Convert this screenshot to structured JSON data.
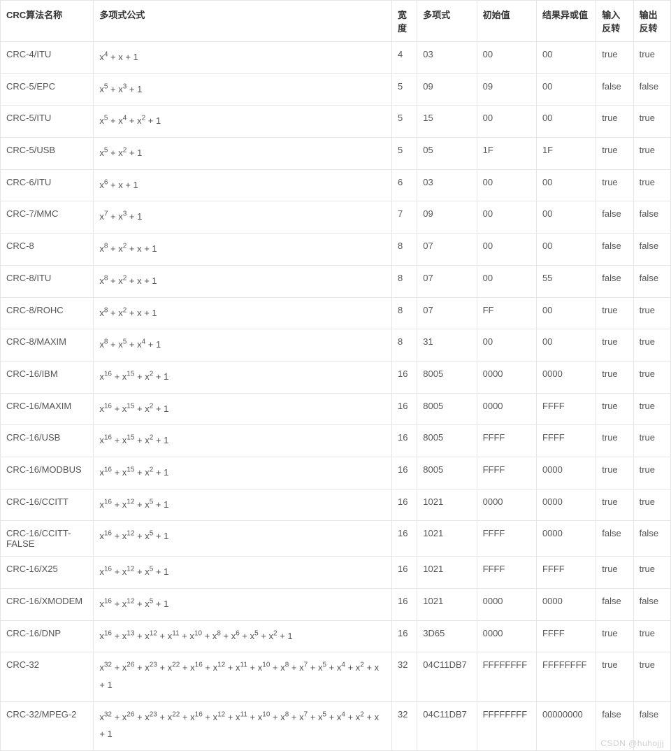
{
  "headers": {
    "name": "CRC算法名称",
    "poly_formula": "多项式公式",
    "width": "宽度",
    "poly": "多项式",
    "init": "初始值",
    "xorout": "结果异或值",
    "refin": "输入反转",
    "refout": "输出反转"
  },
  "watermark": "CSDN @huhojjj",
  "rows": [
    {
      "name": "CRC-4/ITU",
      "exps": [
        4,
        1,
        0
      ],
      "width": "4",
      "poly": "03",
      "init": "00",
      "xorout": "00",
      "refin": "true",
      "refout": "true"
    },
    {
      "name": "CRC-5/EPC",
      "exps": [
        5,
        3,
        0
      ],
      "width": "5",
      "poly": "09",
      "init": "09",
      "xorout": "00",
      "refin": "false",
      "refout": "false"
    },
    {
      "name": "CRC-5/ITU",
      "exps": [
        5,
        4,
        2,
        0
      ],
      "width": "5",
      "poly": "15",
      "init": "00",
      "xorout": "00",
      "refin": "true",
      "refout": "true"
    },
    {
      "name": "CRC-5/USB",
      "exps": [
        5,
        2,
        0
      ],
      "width": "5",
      "poly": "05",
      "init": "1F",
      "xorout": "1F",
      "refin": "true",
      "refout": "true"
    },
    {
      "name": "CRC-6/ITU",
      "exps": [
        6,
        1,
        0
      ],
      "width": "6",
      "poly": "03",
      "init": "00",
      "xorout": "00",
      "refin": "true",
      "refout": "true"
    },
    {
      "name": "CRC-7/MMC",
      "exps": [
        7,
        3,
        0
      ],
      "width": "7",
      "poly": "09",
      "init": "00",
      "xorout": "00",
      "refin": "false",
      "refout": "false"
    },
    {
      "name": "CRC-8",
      "exps": [
        8,
        2,
        1,
        0
      ],
      "width": "8",
      "poly": "07",
      "init": "00",
      "xorout": "00",
      "refin": "false",
      "refout": "false"
    },
    {
      "name": "CRC-8/ITU",
      "exps": [
        8,
        2,
        1,
        0
      ],
      "width": "8",
      "poly": "07",
      "init": "00",
      "xorout": "55",
      "refin": "false",
      "refout": "false"
    },
    {
      "name": "CRC-8/ROHC",
      "exps": [
        8,
        2,
        1,
        0
      ],
      "width": "8",
      "poly": "07",
      "init": "FF",
      "xorout": "00",
      "refin": "true",
      "refout": "true"
    },
    {
      "name": "CRC-8/MAXIM",
      "exps": [
        8,
        5,
        4,
        0
      ],
      "width": "8",
      "poly": "31",
      "init": "00",
      "xorout": "00",
      "refin": "true",
      "refout": "true"
    },
    {
      "name": "CRC-16/IBM",
      "exps": [
        16,
        15,
        2,
        0
      ],
      "width": "16",
      "poly": "8005",
      "init": "0000",
      "xorout": "0000",
      "refin": "true",
      "refout": "true"
    },
    {
      "name": "CRC-16/MAXIM",
      "exps": [
        16,
        15,
        2,
        0
      ],
      "width": "16",
      "poly": "8005",
      "init": "0000",
      "xorout": "FFFF",
      "refin": "true",
      "refout": "true"
    },
    {
      "name": "CRC-16/USB",
      "exps": [
        16,
        15,
        2,
        0
      ],
      "width": "16",
      "poly": "8005",
      "init": "FFFF",
      "xorout": "FFFF",
      "refin": "true",
      "refout": "true"
    },
    {
      "name": "CRC-16/MODBUS",
      "exps": [
        16,
        15,
        2,
        0
      ],
      "width": "16",
      "poly": "8005",
      "init": "FFFF",
      "xorout": "0000",
      "refin": "true",
      "refout": "true"
    },
    {
      "name": "CRC-16/CCITT",
      "exps": [
        16,
        12,
        5,
        0
      ],
      "width": "16",
      "poly": "1021",
      "init": "0000",
      "xorout": "0000",
      "refin": "true",
      "refout": "true"
    },
    {
      "name": "CRC-16/CCITT-FALSE",
      "exps": [
        16,
        12,
        5,
        0
      ],
      "width": "16",
      "poly": "1021",
      "init": "FFFF",
      "xorout": "0000",
      "refin": "false",
      "refout": "false"
    },
    {
      "name": "CRC-16/X25",
      "exps": [
        16,
        12,
        5,
        0
      ],
      "width": "16",
      "poly": "1021",
      "init": "FFFF",
      "xorout": "FFFF",
      "refin": "true",
      "refout": "true"
    },
    {
      "name": "CRC-16/XMODEM",
      "exps": [
        16,
        12,
        5,
        0
      ],
      "width": "16",
      "poly": "1021",
      "init": "0000",
      "xorout": "0000",
      "refin": "false",
      "refout": "false"
    },
    {
      "name": "CRC-16/DNP",
      "exps": [
        16,
        13,
        12,
        11,
        10,
        8,
        6,
        5,
        2,
        0
      ],
      "width": "16",
      "poly": "3D65",
      "init": "0000",
      "xorout": "FFFF",
      "refin": "true",
      "refout": "true"
    },
    {
      "name": "CRC-32",
      "exps": [
        32,
        26,
        23,
        22,
        16,
        12,
        11,
        10,
        8,
        7,
        5,
        4,
        2,
        1,
        0
      ],
      "width": "32",
      "poly": "04C11DB7",
      "init": "FFFFFFFF",
      "xorout": "FFFFFFFF",
      "refin": "true",
      "refout": "true"
    },
    {
      "name": "CRC-32/MPEG-2",
      "exps": [
        32,
        26,
        23,
        22,
        16,
        12,
        11,
        10,
        8,
        7,
        5,
        4,
        2,
        1,
        0
      ],
      "width": "32",
      "poly": "04C11DB7",
      "init": "FFFFFFFF",
      "xorout": "00000000",
      "refin": "false",
      "refout": "false"
    }
  ]
}
